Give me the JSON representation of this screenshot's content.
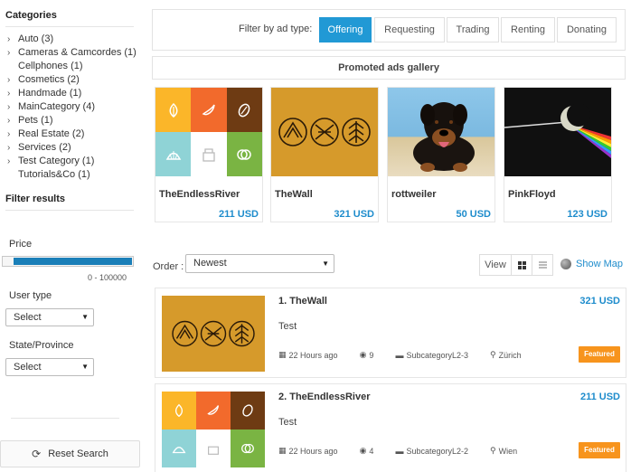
{
  "sidebar": {
    "categories_title": "Categories",
    "categories": [
      {
        "label": "Auto (3)",
        "chevron": true
      },
      {
        "label": "Cameras & Camcordes (1)",
        "chevron": true
      },
      {
        "label": "Cellphones (1)",
        "chevron": false
      },
      {
        "label": "Cosmetics (2)",
        "chevron": true
      },
      {
        "label": "Handmade (1)",
        "chevron": true
      },
      {
        "label": "MainCategory (4)",
        "chevron": true
      },
      {
        "label": "Pets (1)",
        "chevron": true
      },
      {
        "label": "Real Estate (2)",
        "chevron": true
      },
      {
        "label": "Services (2)",
        "chevron": true
      },
      {
        "label": "Test Category (1)",
        "chevron": true
      },
      {
        "label": "Tutorials&Co (1)",
        "chevron": false
      }
    ],
    "filter_title": "Filter results",
    "price_label": "Price",
    "price_range": "0 - 100000",
    "user_type_label": "User type",
    "user_type_value": "Select",
    "state_label": "State/Province",
    "state_value": "Select",
    "reset_label": "Reset Search"
  },
  "filter": {
    "label": "Filter by ad type:",
    "types": [
      "Offering",
      "Requesting",
      "Trading",
      "Renting",
      "Donating"
    ],
    "active": "Offering"
  },
  "gallery": {
    "title": "Promoted ads gallery",
    "cards": [
      {
        "name": "TheEndlessRiver",
        "price": "211 USD",
        "image": "endless-river-tiles"
      },
      {
        "name": "TheWall",
        "price": "321 USD",
        "image": "wall-emblems"
      },
      {
        "name": "rottweiler",
        "price": "50 USD",
        "image": "rottweiler-photo"
      },
      {
        "name": "PinkFloyd",
        "price": "123 USD",
        "image": "pink-floyd-prism"
      }
    ]
  },
  "toolbar": {
    "order_label": "Order :",
    "order_value": "Newest",
    "view_label": "View",
    "show_map": "Show Map"
  },
  "listings": [
    {
      "title": "1. TheWall",
      "price": "321 USD",
      "desc": "Test",
      "time": "22 Hours ago",
      "views": "9",
      "category": "SubcategoryL2-3",
      "location": "Zürich",
      "badge": "Featured",
      "image": "wall-emblems"
    },
    {
      "title": "2. TheEndlessRiver",
      "price": "211 USD",
      "desc": "Test",
      "time": "22 Hours ago",
      "views": "4",
      "category": "SubcategoryL2-2",
      "location": "Wien",
      "badge": "Featured",
      "image": "endless-river-tiles"
    }
  ],
  "colors": {
    "accent": "#2199d5",
    "price": "#1e8ccc",
    "badge": "#f7941d",
    "slider": "#1a7fb8",
    "tile_yellow": "#fbb629",
    "tile_orange": "#f26a2c",
    "tile_brown": "#6e3b13",
    "tile_cyan": "#8fd3d6",
    "tile_green": "#7ab443",
    "wall_gold": "#d69a2b"
  }
}
